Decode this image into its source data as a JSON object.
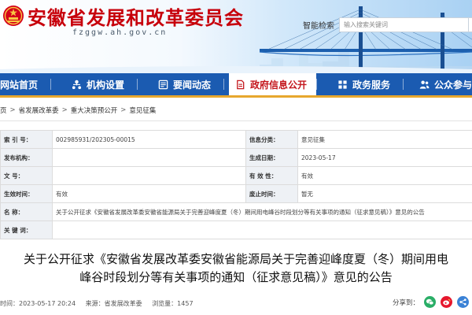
{
  "header": {
    "site_name": "安徽省发展和改革委员会",
    "site_domain": "fzggw.ah.gov.cn",
    "search_label": "智能检索",
    "search_placeholder": "输入搜索关键词"
  },
  "nav": {
    "items": [
      {
        "label": "网站首页",
        "icon": "home-icon",
        "active": false
      },
      {
        "label": "机构设置",
        "icon": "org-icon",
        "active": false
      },
      {
        "label": "要闻动态",
        "icon": "news-icon",
        "active": false
      },
      {
        "label": "政府信息公开",
        "icon": "document-icon",
        "active": true
      },
      {
        "label": "政务服务",
        "icon": "service-icon",
        "active": false
      },
      {
        "label": "公众参与",
        "icon": "people-icon",
        "active": false
      }
    ],
    "colors": {
      "bar": "#1b5bb1",
      "active_text": "#c4171d",
      "underline": "#e7a72d"
    }
  },
  "breadcrumb": {
    "items": [
      "页",
      "省发展改革委",
      "重大决策预公开",
      "意见征集"
    ],
    "separator": ">"
  },
  "meta_table": {
    "rows": [
      {
        "k1": "索 引 号：",
        "v1": "002985931/202305-00015",
        "k2": "信息分类：",
        "v2": "意见征集"
      },
      {
        "k1": "发布机构：",
        "v1": "",
        "k2": "生成日期：",
        "v2": "2023-05-17"
      },
      {
        "k1": "文    号：",
        "v1": "",
        "k2": "有 效 性：",
        "v2": "有效"
      },
      {
        "k1": "生效时间：",
        "v1": "有效",
        "k2": "废止时间：",
        "v2": "暂无"
      }
    ],
    "name_label": "名    称：",
    "name_value": "关于公开征求《安徽省发展改革委安徽省能源局关于完善迎峰度夏（冬）期间用电峰谷时段划分等有关事项的通知（征求意见稿）》意见的公告",
    "keywords_label": "关 键 词：",
    "keywords_value": ""
  },
  "article": {
    "title_line1": "关于公开征求《安徽省发展改革委安徽省能源局关于完善迎峰度夏（冬）期间用电",
    "title_line2": "峰谷时段划分等有关事项的通知（征求意见稿）》意见的公告",
    "published": "时间：2023-05-17 20:24",
    "source": "来源：省发展改革委",
    "views": "浏览量：1457",
    "share_label": "分享到：",
    "share_icons": [
      "wechat-icon",
      "weibo-icon",
      "share-icon"
    ]
  }
}
